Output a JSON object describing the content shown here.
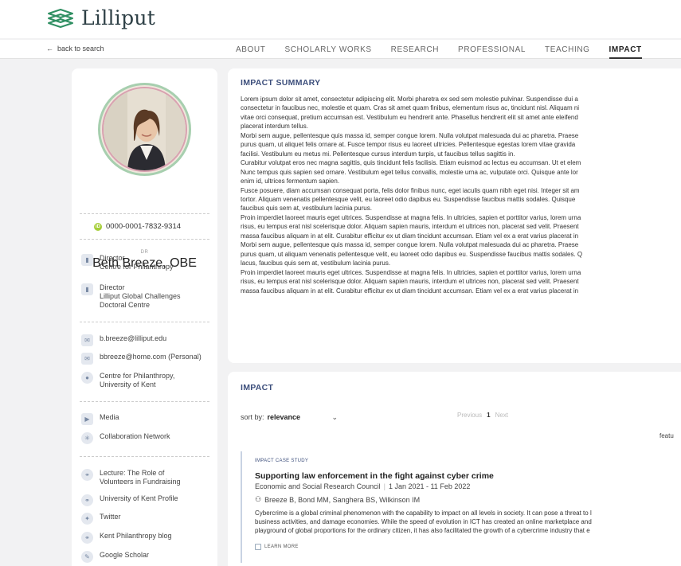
{
  "brand": {
    "name": "Lilliput"
  },
  "nav": {
    "back_label": "back to search",
    "tabs": [
      {
        "label": "ABOUT"
      },
      {
        "label": "SCHOLARLY WORKS"
      },
      {
        "label": "RESEARCH"
      },
      {
        "label": "PROFESSIONAL"
      },
      {
        "label": "TEACHING"
      },
      {
        "label": "IMPACT"
      }
    ],
    "active_tab": "IMPACT"
  },
  "profile": {
    "title": "DR",
    "name": "Beth Breeze, OBE",
    "orcid": "0000-0001-7832-9314",
    "roles": [
      {
        "line1": "Director",
        "line2": "Centre for Philanthropy",
        "line3": ""
      },
      {
        "line1": "Director",
        "line2": "Lilliput Global Challenges",
        "line3": "Doctoral Centre"
      }
    ],
    "contacts": [
      {
        "icon": "mail-icon",
        "text": "b.breeze@lilliput.edu"
      },
      {
        "icon": "mail-icon",
        "text": "bbreeze@home.com (Personal)"
      },
      {
        "icon": "location-pin-icon",
        "text": "Centre for Philanthropy,",
        "text2": "University of Kent"
      }
    ],
    "tools": [
      {
        "icon": "media-icon",
        "text": "Media"
      },
      {
        "icon": "network-icon",
        "text": "Collaboration Network"
      }
    ],
    "links": [
      {
        "icon": "link-icon",
        "text": "Lecture: The Role of",
        "text2": "Volunteers in Fundraising"
      },
      {
        "icon": "link-icon",
        "text": "University of Kent Profile"
      },
      {
        "icon": "twitter-icon",
        "text": "Twitter"
      },
      {
        "icon": "link-icon",
        "text": "Kent Philanthropy blog"
      },
      {
        "icon": "scholar-icon",
        "text": "Google Scholar"
      }
    ]
  },
  "summary": {
    "title": "IMPACT SUMMARY",
    "lines": [
      "Lorem ipsum dolor sit amet, consectetur adipiscing elit. Morbi pharetra ex sed sem molestie pulvinar. Suspendisse dui a",
      "consectetur in faucibus nec, molestie et quam. Cras sit amet quam finibus, elementum risus ac, tincidunt nisl. Aliquam ni",
      "vitae orci consequat, pretium accumsan est. Vestibulum eu hendrerit ante. Phasellus hendrerit elit sit amet ante eleifend",
      "placerat interdum tellus.",
      "Morbi sem augue, pellentesque quis massa id, semper congue lorem. Nulla volutpat malesuada dui ac pharetra. Praese",
      "purus quam, ut aliquet felis ornare at. Fusce tempor risus eu laoreet ultricies. Pellentesque egestas lorem vitae gravida",
      "facilisi. Vestibulum eu metus mi. Pellentesque cursus interdum turpis, ut faucibus tellus sagittis in.",
      "Curabitur volutpat eros nec magna sagittis, quis tincidunt felis facilisis. Etiam euismod ac lectus eu accumsan. Ut et elem",
      "Nunc tempus quis sapien sed ornare. Vestibulum eget tellus convallis, molestie urna ac, vulputate orci. Quisque ante lor",
      "enim id, ultrices fermentum sapien.",
      "Fusce posuere, diam accumsan consequat porta, felis dolor finibus nunc, eget iaculis quam nibh eget nisi. Integer sit am",
      "tortor. Aliquam venenatis pellentesque velit, eu laoreet odio dapibus eu. Suspendisse faucibus mattis sodales. Quisque",
      "faucibus quis sem at, vestibulum lacinia purus.",
      "Proin imperdiet laoreet mauris eget ultrices. Suspendisse at magna felis. In ultricies, sapien et porttitor varius, lorem urna",
      "risus, eu tempus erat nisl scelerisque dolor. Aliquam sapien mauris, interdum et ultrices non, placerat sed velit. Praesent",
      "massa faucibus aliquam in at elit. Curabitur efficitur ex ut diam tincidunt accumsan. Etiam vel ex a erat varius placerat in",
      "Morbi sem augue, pellentesque quis massa id, semper congue lorem. Nulla volutpat malesuada dui ac pharetra. Praese",
      "purus quam, ut aliquam venenatis pellentesque velit, eu laoreet odio dapibus eu. Suspendisse faucibus mattis sodales. Q",
      "lacus, faucibus quis sem at, vestibulum lacinia purus.",
      "Proin imperdiet laoreet mauris eget ultrices. Suspendisse at magna felis. In ultricies, sapien et porttitor varius, lorem urna",
      "risus, eu tempus erat nisl scelerisque dolor. Aliquam sapien mauris, interdum et ultrices non, placerat sed velit. Praesent",
      "massa faucibus aliquam in at elit. Curabitur efficitur ex ut diam tincidunt accumsan. Etiam vel ex a erat varius placerat in"
    ]
  },
  "impact": {
    "title": "IMPACT",
    "sort_prefix": "sort by:",
    "sort_value": "relevance",
    "pager": {
      "prev": "Previous",
      "page": "1",
      "next": "Next"
    },
    "featured_label": "featu",
    "result": {
      "type": "IMPACT CASE STUDY",
      "title": "Supporting law enforcement in the fight against cyber crime",
      "funder": "Economic and Social Research Council",
      "dates": "1 Jan 2021 - 11 Feb 2022",
      "authors": "Breeze B, Bond MM, Sanghera BS, Wilkinson IM",
      "desc": [
        "Cybercrime is a global criminal phenomenon with the capability to impact on all levels in society. It can pose a threat to l",
        "business activities, and damage economies. While the speed of evolution in ICT has created an online marketplace and",
        "playground of global proportions for the ordinary citizen, it has also facilitated the growth of a cybercrime industry that e"
      ],
      "learn_more": "LEARN MORE"
    }
  },
  "colors": {
    "accent": "#3d4f7c",
    "orcid": "#a6ce39",
    "logo": "#2f8f62"
  }
}
